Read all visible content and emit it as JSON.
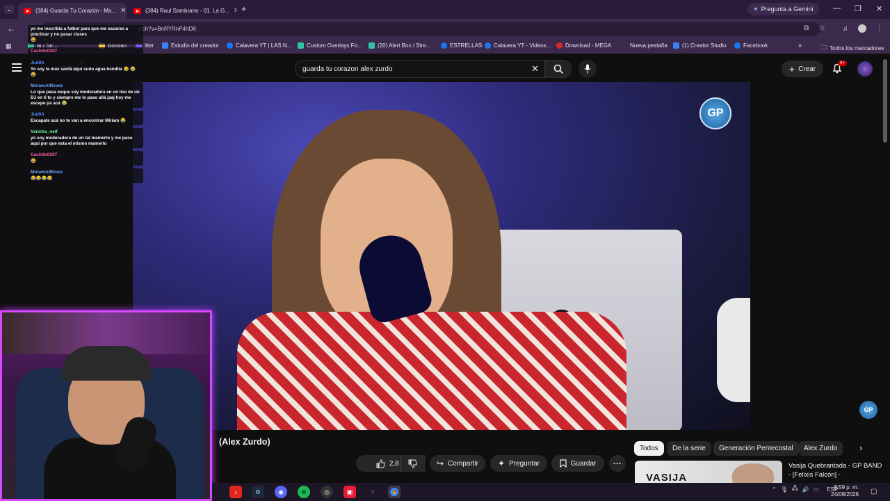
{
  "browser": {
    "tabs": [
      {
        "title": "(384) Guarda Tu Corazón - Ma...",
        "active": true
      },
      {
        "title": "(384) Raul Sambrano - 01. La G...",
        "active": false
      }
    ],
    "new_tab": "+",
    "gemini_label": "Pregunta a Gemini",
    "url": "atch?v=BnRYRnP4hD8",
    "bookmarks": [
      {
        "label": "at / Str...",
        "icon": "streamlabs-icon",
        "color": "#31c3a2"
      },
      {
        "label": "Booyah",
        "icon": "booyah-icon",
        "color": "#f2c94c"
      },
      {
        "label": "itter",
        "icon": "twitter-icon",
        "color": "#7b5cf5"
      },
      {
        "label": "Estudio del creador",
        "icon": "creator-studio-icon",
        "color": "#3b82f6"
      },
      {
        "label": "Calavera YT | LAS N...",
        "icon": "facebook-icon",
        "color": "#1877f2"
      },
      {
        "label": "Custom Overlays Fo...",
        "icon": "overlays-icon",
        "color": "#31c3a2"
      },
      {
        "label": "(20) Alert Box / Stre...",
        "icon": "streamlabs-icon",
        "color": "#31c3a2"
      },
      {
        "label": "ESTRELLAS",
        "icon": "facebook-icon",
        "color": "#1877f2"
      },
      {
        "label": "Calavera YT - Videos...",
        "icon": "facebook-icon",
        "color": "#1877f2"
      },
      {
        "label": "Download - MEGA",
        "icon": "mega-icon",
        "color": "#d9272e"
      },
      {
        "label": "Nueva pestaña",
        "icon": "new-tab-icon",
        "color": "#888888"
      },
      {
        "label": "(1) Creator Studio",
        "icon": "creator-studio-icon",
        "color": "#3b82f6"
      },
      {
        "label": "Facebook",
        "icon": "facebook-icon",
        "color": "#1877f2"
      }
    ],
    "all_bookmarks": "Todos los marcadores"
  },
  "youtube": {
    "search_query": "guarda tu corazon alex zurdo",
    "create_label": "Crear",
    "notif_badge": "9+",
    "video_title_partial": "(Alex Zurdo)",
    "likes": "2,8 K",
    "share_label": "Compartir",
    "ask_label": "Preguntar",
    "save_label": "Guardar",
    "chips": [
      {
        "label": "Todos",
        "active": true
      },
      {
        "label": "De la serie",
        "active": false
      },
      {
        "label": "Generación Pentecostal",
        "active": false
      },
      {
        "label": "Alex Zurdo",
        "active": false
      }
    ],
    "related": {
      "title": "Vasija Quebrantada - GP BAND - [Felixis Falcón] -",
      "thumb_text": "VASIJA"
    },
    "gp_logo": "GP",
    "partial_label": "he",
    "co_label": "co"
  },
  "chat": [
    {
      "user": "",
      "text": "yo me inscribia a futbol para que me sacaran a practicar y no pasar clases",
      "color": "#ffffff"
    },
    {
      "user": "",
      "text": "😂",
      "color": "#ffffff"
    },
    {
      "user": "Cachito0207",
      "text": "😂",
      "color": "#ff5ea8"
    },
    {
      "user": "Judith",
      "text": "Yo soy la más santa aquí sudo agua bendita 😂 😂 😂",
      "color": "#5b8cff"
    },
    {
      "user": "MiriamAlRevez",
      "text": "Lo que pasa esque soy moderadora en un live de un DJ en ti to y siempre me lo paso allá jaaj hoy me escape pa acá 😂",
      "color": "#6fa8ff"
    },
    {
      "user": "Judith",
      "text": "Escapate acá no te van a encontrar Miriam 😂",
      "color": "#5b8cff"
    },
    {
      "user": "Verinha_neif",
      "text": "yo soy moderadora de un tal mamerto y me paso aquí por que esta el mismo mamerto",
      "color": "#6dff9a"
    },
    {
      "user": "Cachito0207",
      "text": "😂",
      "color": "#ff5ea8"
    },
    {
      "user": "MiriamAlRevez",
      "text": "😂😂😂😂",
      "color": "#6fa8ff"
    }
  ],
  "taskbar": {
    "lang": "ESP",
    "time": "8:59 p. m.",
    "date": "24/08/2026"
  }
}
